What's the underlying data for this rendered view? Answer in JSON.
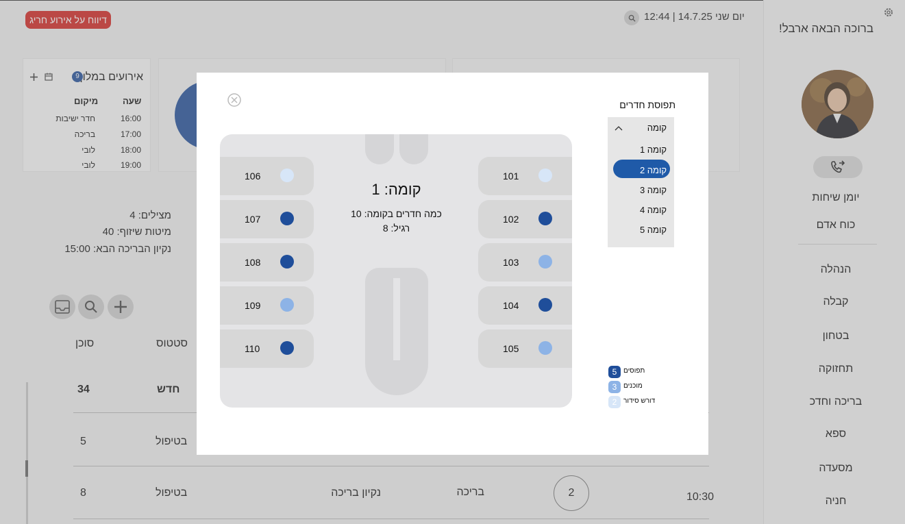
{
  "header": {
    "alert_button": "דיווח על אירוע חריג",
    "datetime": "יום שני 14.7.25 | 12:44"
  },
  "sidebar": {
    "welcome": "ברוכה הבאה ארבל!",
    "items": [
      {
        "label": "יומן שיחות"
      },
      {
        "label": "כוח אדם"
      },
      {
        "label": "הנהלה"
      },
      {
        "label": "קבלה"
      },
      {
        "label": "בטחון"
      },
      {
        "label": "תחזוקה"
      },
      {
        "label": "בריכה וחדכ"
      },
      {
        "label": "ספא"
      },
      {
        "label": "מסעדה"
      },
      {
        "label": "חניה"
      }
    ]
  },
  "events_card": {
    "title": "אירועים במלון",
    "count": "9",
    "headers": {
      "time": "שעה",
      "location": "מיקום"
    },
    "rows": [
      {
        "time": "16:00",
        "location": "חדר ישיבות"
      },
      {
        "time": "17:00",
        "location": "בריכה"
      },
      {
        "time": "18:00",
        "location": "לובי"
      },
      {
        "time": "19:00",
        "location": "לובי"
      }
    ]
  },
  "pool_info": {
    "lifeguards": "מצילים: 4",
    "sun_beds": "מיטות שיזוף: 40",
    "next_cleaning": "נקיון הבריכה הבא: 15:00"
  },
  "tasks_table": {
    "headers": {
      "agent": "סוכן",
      "status": "סטטוס"
    },
    "summary": {
      "agent": "34",
      "status": "חדש"
    },
    "rows": [
      {
        "agent": "5",
        "status": "בטיפול",
        "task": "",
        "location": "",
        "priority": "",
        "time": ""
      },
      {
        "agent": "8",
        "status": "בטיפול",
        "task": "נקיון בריכה",
        "location": "בריכה",
        "priority": "2",
        "time": "10:30"
      }
    ]
  },
  "modal": {
    "title": "תפוסת חדרים",
    "floor_dropdown_label": "קומה",
    "floors": [
      "קומה 1",
      "קומה 2",
      "קומה 3",
      "קומה 4",
      "קומה 5"
    ],
    "selected_floor_index": 1,
    "floor_name": "קומה: 1",
    "room_count": "כמה חדרים בקומה: 10",
    "regular": "רגיל: 8",
    "rooms": [
      {
        "number": "101",
        "status": "needs-arrangement"
      },
      {
        "number": "102",
        "status": "occupied"
      },
      {
        "number": "103",
        "status": "ready"
      },
      {
        "number": "104",
        "status": "occupied"
      },
      {
        "number": "105",
        "status": "ready"
      },
      {
        "number": "106",
        "status": "needs-arrangement"
      },
      {
        "number": "107",
        "status": "occupied"
      },
      {
        "number": "108",
        "status": "occupied"
      },
      {
        "number": "109",
        "status": "ready"
      },
      {
        "number": "110",
        "status": "occupied"
      }
    ],
    "legend": [
      {
        "count": "5",
        "label": "תפוסים",
        "color": "#1f4e9a"
      },
      {
        "count": "3",
        "label": "מוכנים",
        "color": "#8db3e6"
      },
      {
        "count": "2",
        "label": "דורש סידור",
        "color": "#d7e6f8"
      }
    ],
    "status_colors": {
      "occupied": "#1f4e9a",
      "ready": "#8db3e6",
      "needs-arrangement": "#d7e6f8"
    }
  }
}
